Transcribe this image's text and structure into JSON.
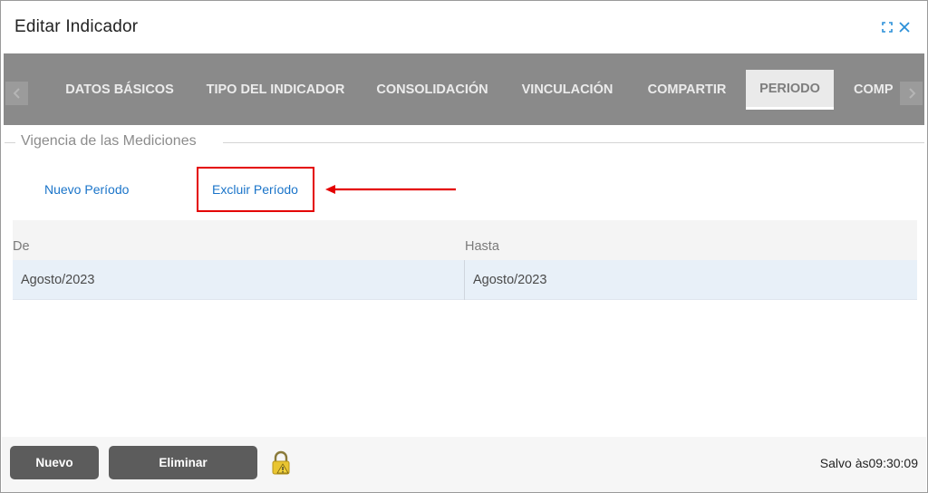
{
  "window": {
    "title": "Editar Indicador",
    "icons": [
      "maximize-icon",
      "close-icon"
    ]
  },
  "tabs": [
    {
      "label": "DATOS BÁSICOS",
      "active": false
    },
    {
      "label": "TIPO DEL INDICADOR",
      "active": false
    },
    {
      "label": "CONSOLIDACIÓN",
      "active": false
    },
    {
      "label": "VINCULACIÓN",
      "active": false
    },
    {
      "label": "COMPARTIR",
      "active": false
    },
    {
      "label": "PERIODO",
      "active": true
    },
    {
      "label": "COMP",
      "active": false
    }
  ],
  "section": {
    "legend": "Vigencia de las Mediciones",
    "actions": {
      "new_label": "Nuevo Período",
      "delete_label": "Excluir Período"
    }
  },
  "grid": {
    "columns": [
      "De",
      "Hasta"
    ],
    "rows": [
      [
        "Agosto/2023",
        "Agosto/2023"
      ]
    ]
  },
  "footer": {
    "new_label": "Nuevo",
    "delete_label": "Eliminar",
    "status": "Salvo às09:30:09",
    "lock_icon": "padlock-warning-icon"
  },
  "colors": {
    "accent_link": "#1a74c9",
    "annotation_red": "#e40000",
    "tabbar_bg": "#8a8a8a",
    "button_bg": "#5c5c5c"
  }
}
